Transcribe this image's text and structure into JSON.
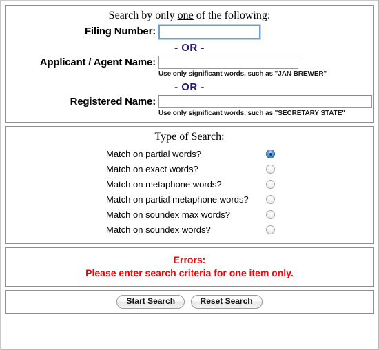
{
  "criteria": {
    "heading_pre": "Search by only ",
    "heading_underlined": "one",
    "heading_post": " of the following:",
    "separator": "- OR -",
    "fields": [
      {
        "label": "Filing Number:",
        "value": "",
        "placeholder": "",
        "hint": "",
        "focused": true
      },
      {
        "label": "Applicant / Agent Name:",
        "value": "",
        "placeholder": "",
        "hint": "Use only significant words, such as \"JAN BREWER\"",
        "focused": false
      },
      {
        "label": "Registered Name:",
        "value": "",
        "placeholder": "",
        "hint": "Use only significant words, such as \"SECRETARY STATE\"",
        "focused": false
      }
    ]
  },
  "search_type": {
    "heading": "Type of Search:",
    "selected": "partial",
    "options": [
      {
        "id": "partial",
        "label": "Match on partial words?",
        "checked": true
      },
      {
        "id": "exact",
        "label": "Match on exact words?",
        "checked": false
      },
      {
        "id": "metaphone",
        "label": "Match on metaphone words?",
        "checked": false
      },
      {
        "id": "partial-metaphone",
        "label": "Match on partial metaphone words?",
        "checked": false
      },
      {
        "id": "soundex-max",
        "label": "Match on soundex max words?",
        "checked": false
      },
      {
        "id": "soundex",
        "label": "Match on soundex words?",
        "checked": false
      }
    ]
  },
  "errors": {
    "title": "Errors:",
    "message": "Please enter search criteria for one item only."
  },
  "actions": {
    "start_label": "Start Search",
    "reset_label": "Reset Search"
  },
  "colors": {
    "separator": "#2b1a7a",
    "error": "#ff0000",
    "focus_ring": "#6f9fd0",
    "radio_selected": "#2f6fb8"
  }
}
